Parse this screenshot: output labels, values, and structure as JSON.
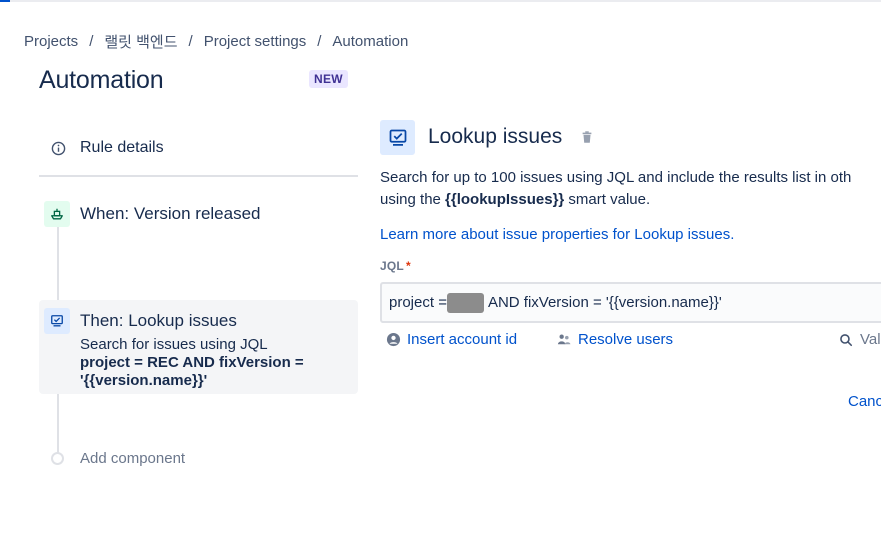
{
  "breadcrumb": {
    "items": [
      "Projects",
      "랠릿 백엔드",
      "Project settings",
      "Automation"
    ],
    "separator": "/"
  },
  "page": {
    "title": "Automation",
    "new_badge": "NEW"
  },
  "rule_editor": {
    "rule_details_label": "Rule details",
    "trigger_label": "When: Version released",
    "action": {
      "title": "Then: Lookup issues",
      "desc_line1": "Search for issues using JQL",
      "desc_line2": "project = REC AND fixVersion =",
      "desc_line3": "'{{version.name}}'"
    },
    "add_component_label": "Add component"
  },
  "panel": {
    "title": "Lookup issues",
    "desc_line1": "Search for up to 100 issues using JQL and include the results list in oth",
    "desc_line2_prefix": "using the ",
    "desc_line2_strong": "{{lookupIssues}}",
    "desc_line2_suffix": " smart value.",
    "learn_more": "Learn more about issue properties for Lookup issues.",
    "jql_label": "JQL",
    "required_mark": "*",
    "jql_prefix": "project = ",
    "jql_suffix": "AND fixVersion = '{{version.name}}'",
    "helpers": {
      "insert_account_id": "Insert account id",
      "resolve_users": "Resolve users",
      "validate": "Val"
    },
    "cancel_label": "Canc"
  },
  "colors": {
    "link": "#0052cc",
    "text": "#172b4d",
    "trigger_bg": "#e3fcef",
    "action_bg": "#deebff",
    "new_badge_bg": "#eae6ff",
    "required": "#de350b"
  },
  "icons": {
    "rule_details": "info-icon",
    "trigger": "version-ship-icon",
    "action": "monitor-check-icon",
    "delete": "trash-icon",
    "account": "user-circle-icon",
    "users": "people-icon",
    "validate": "search-icon"
  }
}
